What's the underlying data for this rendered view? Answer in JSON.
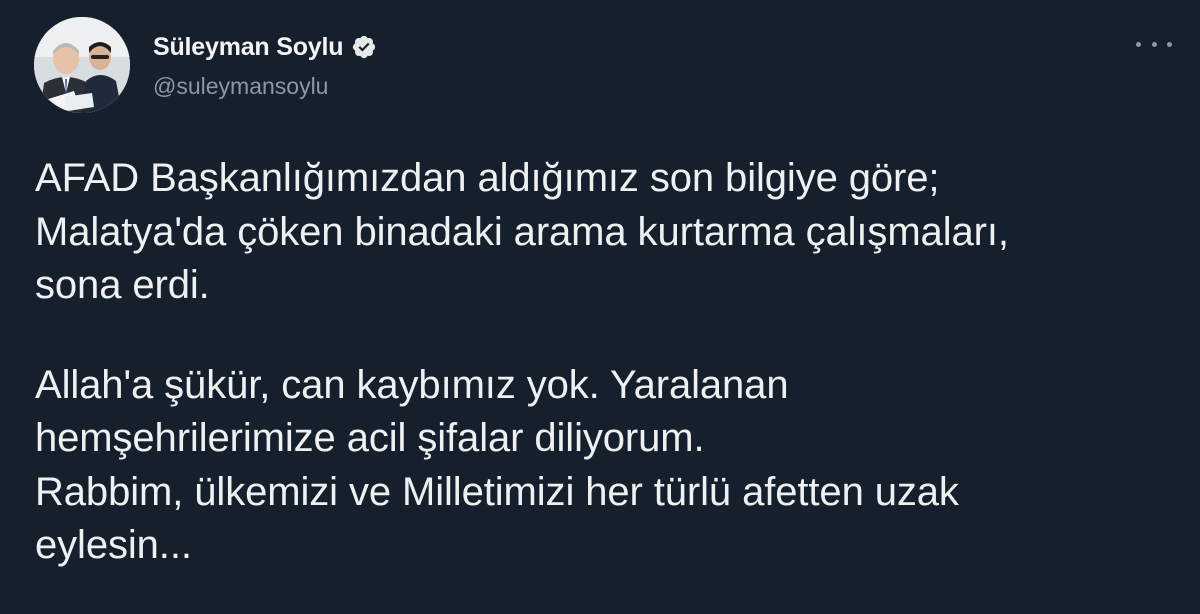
{
  "author": {
    "display_name": "Süleyman Soylu",
    "handle": "@suleymansoylu",
    "verified": true,
    "avatar_icon": "profile-photo"
  },
  "more_icon": "ellipsis-icon",
  "tweet": {
    "paragraph1": [
      "AFAD Başkanlığımızdan aldığımız son bilgiye göre;",
      "Malatya'da çöken binadaki arama kurtarma çalışmaları,",
      "sona erdi."
    ],
    "paragraph2": [
      "Allah'a şükür, can kaybımız yok. Yaralanan",
      "hemşehrilerimize acil şifalar diliyorum.",
      "Rabbim, ülkemizi ve Milletimizi her türlü afetten uzak",
      "eylesin..."
    ]
  },
  "colors": {
    "background": "#16202c",
    "text_primary": "#eef1f2",
    "text_secondary": "#8b98a5",
    "verified_badge": "#e7e9ea"
  }
}
